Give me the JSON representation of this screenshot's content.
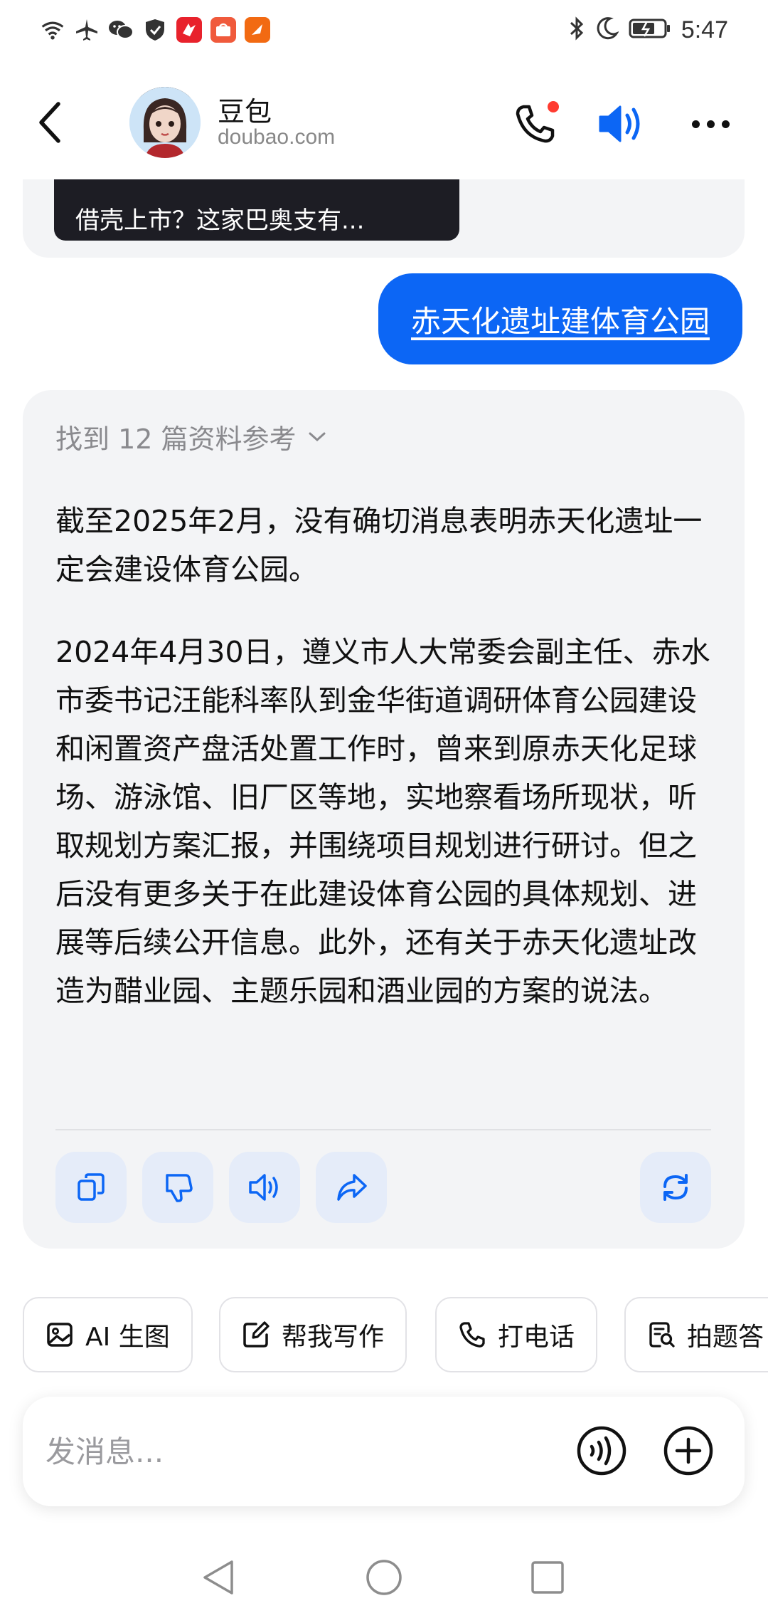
{
  "status_bar": {
    "time": "5:47",
    "left_icons": [
      "wifi-icon",
      "airplane-icon",
      "wechat-icon",
      "shield-icon",
      "app-icon-1",
      "app-icon-2",
      "app-icon-3"
    ],
    "right_icons": [
      "bluetooth-icon",
      "moon-icon",
      "battery-icon"
    ]
  },
  "header": {
    "title": "豆包",
    "subtitle": "doubao.com",
    "accent": "#0c66f5"
  },
  "previous_message": {
    "card_text": "借壳上市？这家巴奥支有..."
  },
  "user_message": {
    "text": "赤天化遗址建体育公园"
  },
  "bot_message": {
    "refs_label": "找到 12 篇资料参考",
    "paragraphs": [
      "截至2025年2月，没有确切消息表明赤天化遗址一定会建设体育公园。",
      "2024年4月30日，遵义市人大常委会副主任、赤水市委书记汪能科率队到金华街道调研体育公园建设和闲置资产盘活处置工作时，曾来到原赤天化足球场、游泳馆、旧厂区等地，实地察看场所现状，听取规划方案汇报，并围绕项目规划进行研讨。但之后没有更多关于在此建设体育公园的具体规划、进展等后续公开信息。此外，还有关于赤天化遗址改造为醋业园、主题乐园和酒业园的方案的说法。"
    ],
    "actions": [
      "copy-icon",
      "thumbs-down-icon",
      "speaker-icon",
      "share-icon",
      "regenerate-icon"
    ]
  },
  "chips": [
    {
      "label": "AI 生图",
      "icon": "image-icon"
    },
    {
      "label": "帮我写作",
      "icon": "edit-icon"
    },
    {
      "label": "打电话",
      "icon": "phone-icon"
    },
    {
      "label": "拍题答",
      "icon": "scan-doc-icon"
    }
  ],
  "input": {
    "placeholder": "发消息..."
  },
  "nav": [
    "back-triangle-icon",
    "home-circle-icon",
    "recents-square-icon"
  ]
}
